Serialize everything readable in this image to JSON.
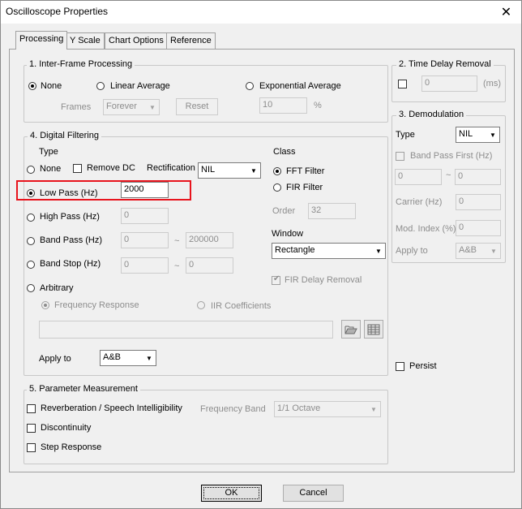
{
  "window": {
    "title": "Oscilloscope Properties",
    "close_glyph": "✕"
  },
  "tabs": [
    {
      "label": "Processing",
      "active": true
    },
    {
      "label": "Y Scale"
    },
    {
      "label": "Chart Options"
    },
    {
      "label": "Reference"
    }
  ],
  "inter_frame": {
    "title": "1. Inter-Frame Processing",
    "opt_none": "None",
    "opt_linear": "Linear Average",
    "opt_exponential": "Exponential Average",
    "frames_label": "Frames",
    "frames_value": "Forever",
    "reset_label": "Reset",
    "exp_value": "10",
    "exp_unit": "%"
  },
  "time_delay": {
    "title": "2. Time Delay Removal",
    "value": "0",
    "unit": "(ms)"
  },
  "demodulation": {
    "title": "3. Demodulation",
    "type_label": "Type",
    "type_value": "NIL",
    "band_pass_first": "Band Pass First (Hz)",
    "low_value": "0",
    "tilde": "~",
    "high_value": "0",
    "carrier_label": "Carrier (Hz)",
    "carrier_value": "0",
    "mod_index_label": "Mod. Index (%)",
    "mod_index_value": "0",
    "apply_label": "Apply to",
    "apply_value": "A&B"
  },
  "digital_filtering": {
    "title": "4. Digital Filtering",
    "type_label": "Type",
    "opt_none": "None",
    "remove_dc": "Remove DC",
    "rectification_label": "Rectification",
    "rectification_value": "NIL",
    "low_pass": "Low Pass (Hz)",
    "low_pass_value": "2000",
    "high_pass": "High Pass (Hz)",
    "high_pass_value": "0",
    "band_pass": "Band Pass (Hz)",
    "band_pass_low": "0",
    "band_pass_high": "200000",
    "band_stop": "Band Stop (Hz)",
    "band_stop_low": "0",
    "band_stop_high": "0",
    "tilde": "~",
    "arbitrary": "Arbitrary",
    "freq_response": "Frequency Response",
    "iir_coefficients": "IIR Coefficients",
    "file_value": "",
    "apply_label": "Apply to",
    "apply_value": "A&B",
    "class_label": "Class",
    "fft_filter": "FFT Filter",
    "fir_filter": "FIR Filter",
    "order_label": "Order",
    "order_value": "32",
    "window_label": "Window",
    "window_value": "Rectangle",
    "fir_delay_removal": "FIR Delay Removal"
  },
  "persist_label": "Persist",
  "parameter_measurement": {
    "title": "5. Parameter Measurement",
    "reverberation": "Reverberation / Speech Intelligibility",
    "frequency_band_label": "Frequency Band",
    "frequency_band_value": "1/1 Octave",
    "discontinuity": "Discontinuity",
    "step_response": "Step Response"
  },
  "footer": {
    "ok_label": "OK",
    "cancel_label": "Cancel"
  },
  "colors": {
    "highlight_box": "#e8141d",
    "dialog_bg": "#f0f0f0"
  },
  "icons": {
    "folder": "folder-open-icon",
    "table": "table-grid-icon",
    "dropdown": "chevron-down-icon"
  }
}
